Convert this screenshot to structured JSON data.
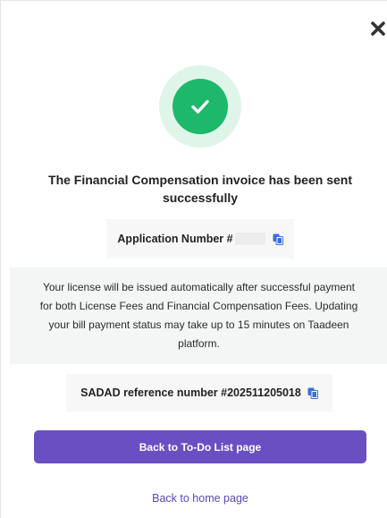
{
  "dialog": {
    "close_icon": "close-x-icon",
    "success_icon": "check-circle-icon",
    "title_line1": "The Financial Compensation invoice has been sent",
    "title_line2": "successfully",
    "application_number_label": "Application Number #",
    "application_number_value": "",
    "copy_icon": "copy-icon",
    "info_line1": "Your license will be issued automatically after successful payment",
    "info_line2": "for both License Fees and Financial Compensation Fees. Updating",
    "info_line3": "your bill payment status may take up to 15 minutes on Taadeen",
    "info_line4": "platform.",
    "sadad_label": "SADAD reference number #202511205018",
    "primary_button_label": "Back to To-Do List page",
    "home_link_label": "Back to home page"
  },
  "colors": {
    "success_green": "#1db86a",
    "success_halo": "#dff5ea",
    "primary_purple": "#6a4fc3",
    "link_purple": "#5b46b8",
    "copy_icon_blue": "#3b6fd8"
  }
}
